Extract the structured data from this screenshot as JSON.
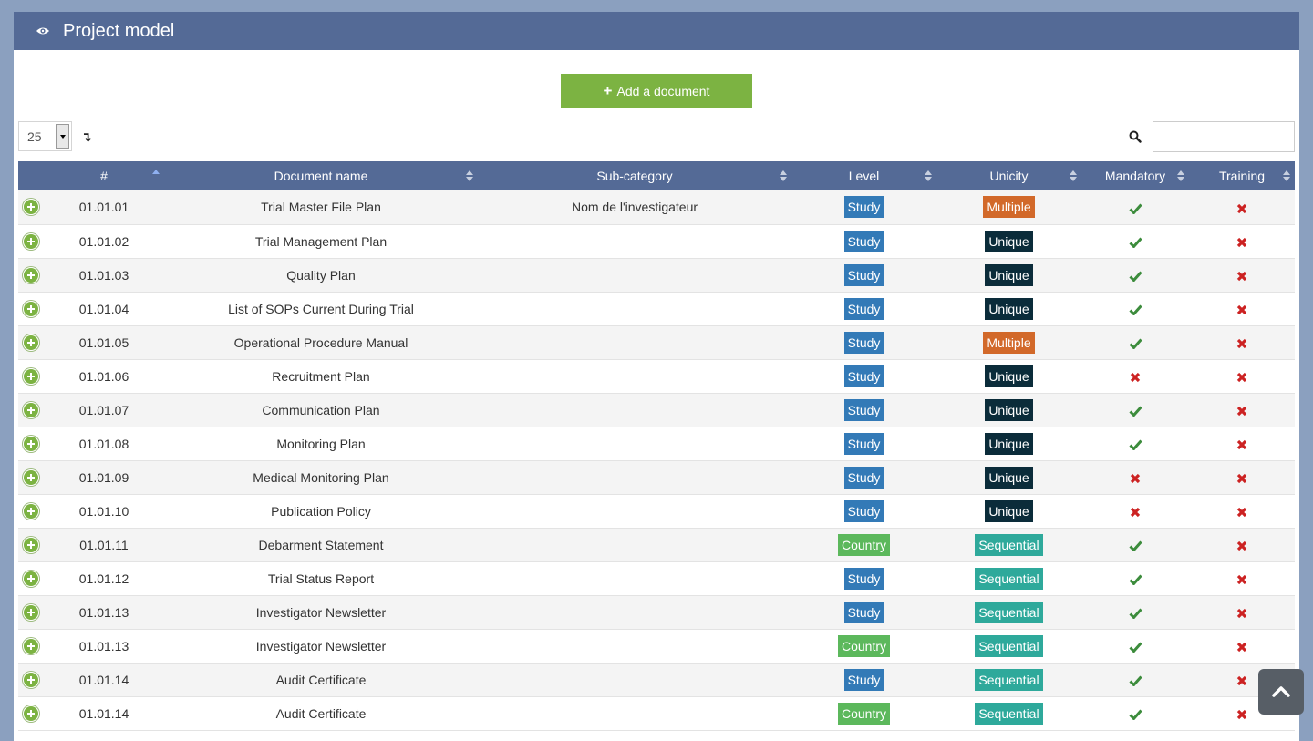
{
  "header": {
    "title": "Project model",
    "icon": "eye-icon"
  },
  "toolbar": {
    "add_label": "Add a document"
  },
  "length_select": {
    "value": "25"
  },
  "search": {
    "value": ""
  },
  "colors": {
    "header": "#546a96",
    "add_button": "#7cb342",
    "level": {
      "Study": "#337ab7",
      "Country": "#5cb85c"
    },
    "unicity": {
      "Multiple": "#d2692a",
      "Unique": "#0b2c3a",
      "Sequential": "#2ea99b"
    },
    "check": "#3c8c3c",
    "cross": "#cc2222"
  },
  "columns": [
    "#",
    "Document name",
    "Sub-category",
    "Level",
    "Unicity",
    "Mandatory",
    "Training"
  ],
  "rows": [
    {
      "num": "01.01.01",
      "name": "Trial Master File Plan",
      "sub": "Nom de l'investigateur",
      "level": "Study",
      "unicity": "Multiple",
      "mandatory": true,
      "training": false
    },
    {
      "num": "01.01.02",
      "name": "Trial Management Plan",
      "sub": "",
      "level": "Study",
      "unicity": "Unique",
      "mandatory": true,
      "training": false
    },
    {
      "num": "01.01.03",
      "name": "Quality Plan",
      "sub": "",
      "level": "Study",
      "unicity": "Unique",
      "mandatory": true,
      "training": false
    },
    {
      "num": "01.01.04",
      "name": "List of SOPs Current During Trial",
      "sub": "",
      "level": "Study",
      "unicity": "Unique",
      "mandatory": true,
      "training": false
    },
    {
      "num": "01.01.05",
      "name": "Operational Procedure Manual",
      "sub": "",
      "level": "Study",
      "unicity": "Multiple",
      "mandatory": true,
      "training": false
    },
    {
      "num": "01.01.06",
      "name": "Recruitment Plan",
      "sub": "",
      "level": "Study",
      "unicity": "Unique",
      "mandatory": false,
      "training": false
    },
    {
      "num": "01.01.07",
      "name": "Communication Plan",
      "sub": "",
      "level": "Study",
      "unicity": "Unique",
      "mandatory": true,
      "training": false
    },
    {
      "num": "01.01.08",
      "name": "Monitoring Plan",
      "sub": "",
      "level": "Study",
      "unicity": "Unique",
      "mandatory": true,
      "training": false
    },
    {
      "num": "01.01.09",
      "name": "Medical Monitoring Plan",
      "sub": "",
      "level": "Study",
      "unicity": "Unique",
      "mandatory": false,
      "training": false
    },
    {
      "num": "01.01.10",
      "name": "Publication Policy",
      "sub": "",
      "level": "Study",
      "unicity": "Unique",
      "mandatory": false,
      "training": false
    },
    {
      "num": "01.01.11",
      "name": "Debarment Statement",
      "sub": "",
      "level": "Country",
      "unicity": "Sequential",
      "mandatory": true,
      "training": false
    },
    {
      "num": "01.01.12",
      "name": "Trial Status Report",
      "sub": "",
      "level": "Study",
      "unicity": "Sequential",
      "mandatory": true,
      "training": false
    },
    {
      "num": "01.01.13",
      "name": "Investigator Newsletter",
      "sub": "",
      "level": "Study",
      "unicity": "Sequential",
      "mandatory": true,
      "training": false
    },
    {
      "num": "01.01.13",
      "name": "Investigator Newsletter",
      "sub": "",
      "level": "Country",
      "unicity": "Sequential",
      "mandatory": true,
      "training": false
    },
    {
      "num": "01.01.14",
      "name": "Audit Certificate",
      "sub": "",
      "level": "Study",
      "unicity": "Sequential",
      "mandatory": true,
      "training": false
    },
    {
      "num": "01.01.14",
      "name": "Audit Certificate",
      "sub": "",
      "level": "Country",
      "unicity": "Sequential",
      "mandatory": true,
      "training": false
    }
  ]
}
